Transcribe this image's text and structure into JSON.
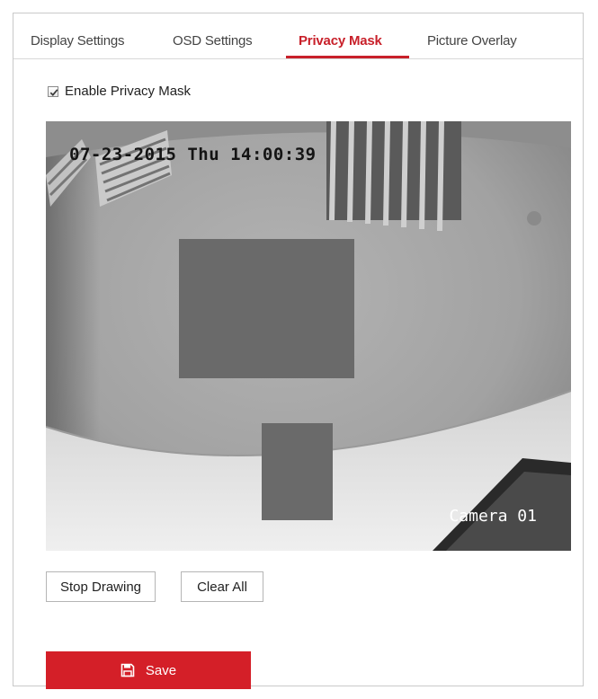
{
  "tabs": [
    {
      "label": "Display Settings",
      "active": false
    },
    {
      "label": "OSD Settings",
      "active": false
    },
    {
      "label": "Privacy Mask",
      "active": true
    },
    {
      "label": "Picture Overlay",
      "active": false
    }
  ],
  "enable_privacy_mask": {
    "label": "Enable Privacy Mask",
    "checked": true
  },
  "video": {
    "timestamp": "07-23-2015 Thu 14:00:39",
    "camera_name": "Camera 01"
  },
  "buttons": {
    "stop_drawing": "Stop Drawing",
    "clear_all": "Clear All",
    "save": "Save"
  },
  "colors": {
    "accent": "#c8202a",
    "save_button": "#d41f28",
    "mask": "#6a6a6a"
  },
  "icons": {
    "save": "floppy-disk-icon",
    "checkbox": "checkmark-icon"
  }
}
